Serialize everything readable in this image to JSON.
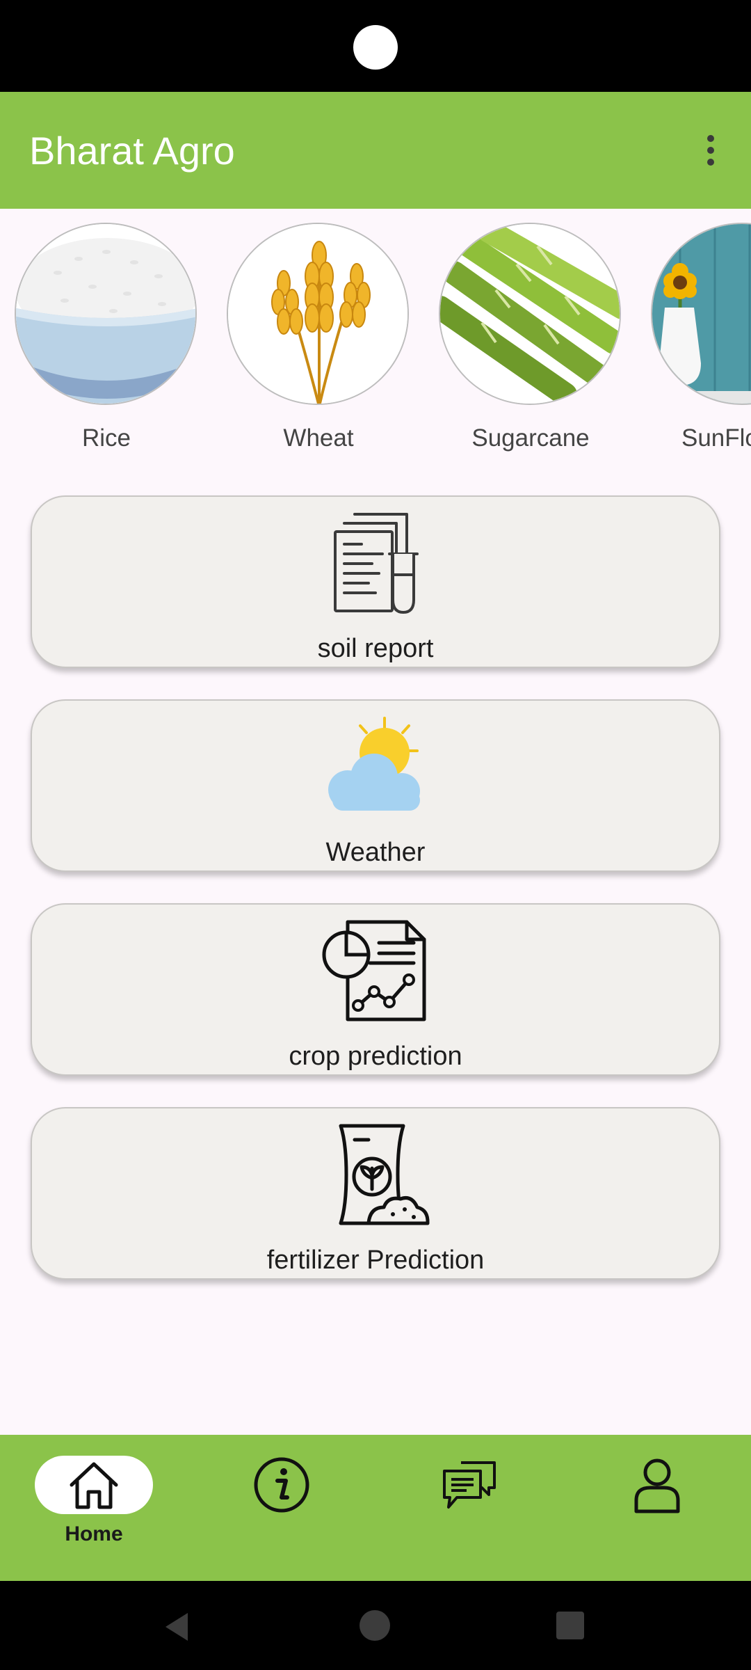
{
  "app_bar": {
    "title": "Bharat Agro",
    "menu_icon": "more-vert-icon"
  },
  "crops": [
    {
      "name": "Rice",
      "image": "rice-bowl-image"
    },
    {
      "name": "Wheat",
      "image": "wheat-image"
    },
    {
      "name": "Sugarcane",
      "image": "sugarcane-image"
    },
    {
      "name": "SunFlo",
      "image": "sunflower-image"
    }
  ],
  "cards": [
    {
      "label": "soil report",
      "icon": "soil-report-icon"
    },
    {
      "label": "Weather",
      "icon": "weather-icon"
    },
    {
      "label": "crop prediction",
      "icon": "crop-prediction-icon"
    },
    {
      "label": "fertilizer Prediction",
      "icon": "fertilizer-icon"
    }
  ],
  "bottom_nav": {
    "items": [
      {
        "label": "Home",
        "icon": "home-icon",
        "active": true
      },
      {
        "label": "",
        "icon": "info-icon",
        "active": false
      },
      {
        "label": "",
        "icon": "chat-icon",
        "active": false
      },
      {
        "label": "",
        "icon": "profile-icon",
        "active": false
      }
    ]
  },
  "colors": {
    "primary": "#8bc34a",
    "background": "#fdf7fc",
    "card": "#f2f0ed"
  }
}
